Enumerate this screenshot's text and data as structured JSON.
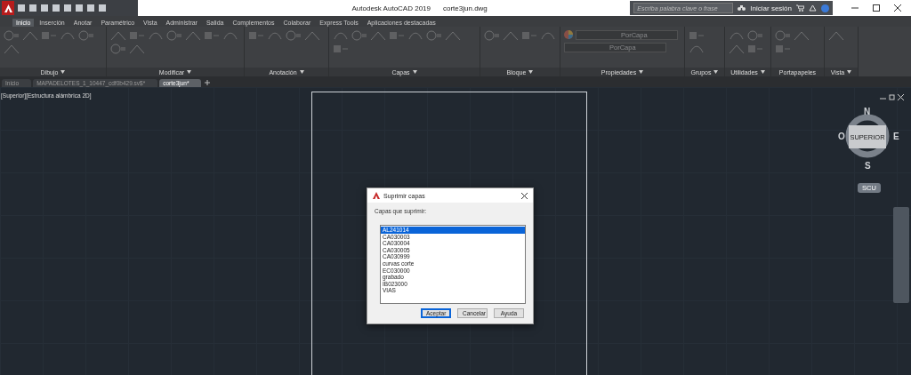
{
  "window": {
    "title": "Autodesk AutoCAD 2019",
    "file": "corte3jun.dwg"
  },
  "search": {
    "placeholder": "Escriba palabra clave o frase"
  },
  "user": {
    "label": "Iniciar sesión"
  },
  "ribbon_tabs": [
    {
      "label": "Inicio",
      "selected": true
    },
    {
      "label": "Inserción",
      "selected": false
    },
    {
      "label": "Anotar",
      "selected": false
    },
    {
      "label": "Paramétrico",
      "selected": false
    },
    {
      "label": "Vista",
      "selected": false
    },
    {
      "label": "Administrar",
      "selected": false
    },
    {
      "label": "Salida",
      "selected": false
    },
    {
      "label": "Complementos",
      "selected": false
    },
    {
      "label": "Colaborar",
      "selected": false
    },
    {
      "label": "Express Tools",
      "selected": false
    },
    {
      "label": "Aplicaciones destacadas",
      "selected": false
    }
  ],
  "ribbon": {
    "disabled": true,
    "panels": [
      {
        "title": "Dibujo",
        "kind": "tools",
        "dropdown": true
      },
      {
        "title": "Modificar",
        "kind": "tools",
        "dropdown": true
      },
      {
        "title": "Anotación",
        "kind": "tools",
        "dropdown": true
      },
      {
        "title": "Capas",
        "kind": "tools",
        "dropdown": true
      },
      {
        "title": "Bloque",
        "kind": "tools",
        "dropdown": true
      },
      {
        "title": "Propiedades",
        "kind": "properties",
        "dropdown": true,
        "fields": [
          "PorCapa",
          "PorCapa"
        ]
      },
      {
        "title": "Grupos",
        "kind": "tools",
        "dropdown": true
      },
      {
        "title": "Utilidades",
        "kind": "tools",
        "dropdown": true
      },
      {
        "title": "Portapapeles",
        "kind": "tools",
        "dropdown": false
      },
      {
        "title": "Vista",
        "kind": "tools",
        "dropdown": true
      }
    ]
  },
  "file_tabs": [
    {
      "label": "Inicio",
      "selected": false
    },
    {
      "label": "MAPADELOTES_1_10447_cdf0b429.sv$*",
      "selected": false
    },
    {
      "label": "corte3jun*",
      "selected": true
    }
  ],
  "viewport": {
    "label": "[Superior][Estructura alámbrica 2D]"
  },
  "viewcube": {
    "north": "N",
    "east": "E",
    "south": "S",
    "west": "O",
    "face": "SUPERIOR",
    "ucs": "SCU"
  },
  "dialog": {
    "title": "Suprimir capas",
    "prompt": "Capas que suprimir:",
    "items": [
      {
        "label": "AL241014",
        "selected": true
      },
      {
        "label": "CA030003",
        "selected": false
      },
      {
        "label": "CA030004",
        "selected": false
      },
      {
        "label": "CA030005",
        "selected": false
      },
      {
        "label": "CA030999",
        "selected": false
      },
      {
        "label": "curvas corte",
        "selected": false
      },
      {
        "label": "EC030000",
        "selected": false
      },
      {
        "label": "grabado",
        "selected": false
      },
      {
        "label": "IB023000",
        "selected": false
      },
      {
        "label": "VIAS",
        "selected": false
      }
    ],
    "buttons": [
      {
        "label": "Aceptar",
        "default": true
      },
      {
        "label": "Cancelar",
        "default": false
      },
      {
        "label": "Ayuda",
        "default": false
      }
    ]
  }
}
